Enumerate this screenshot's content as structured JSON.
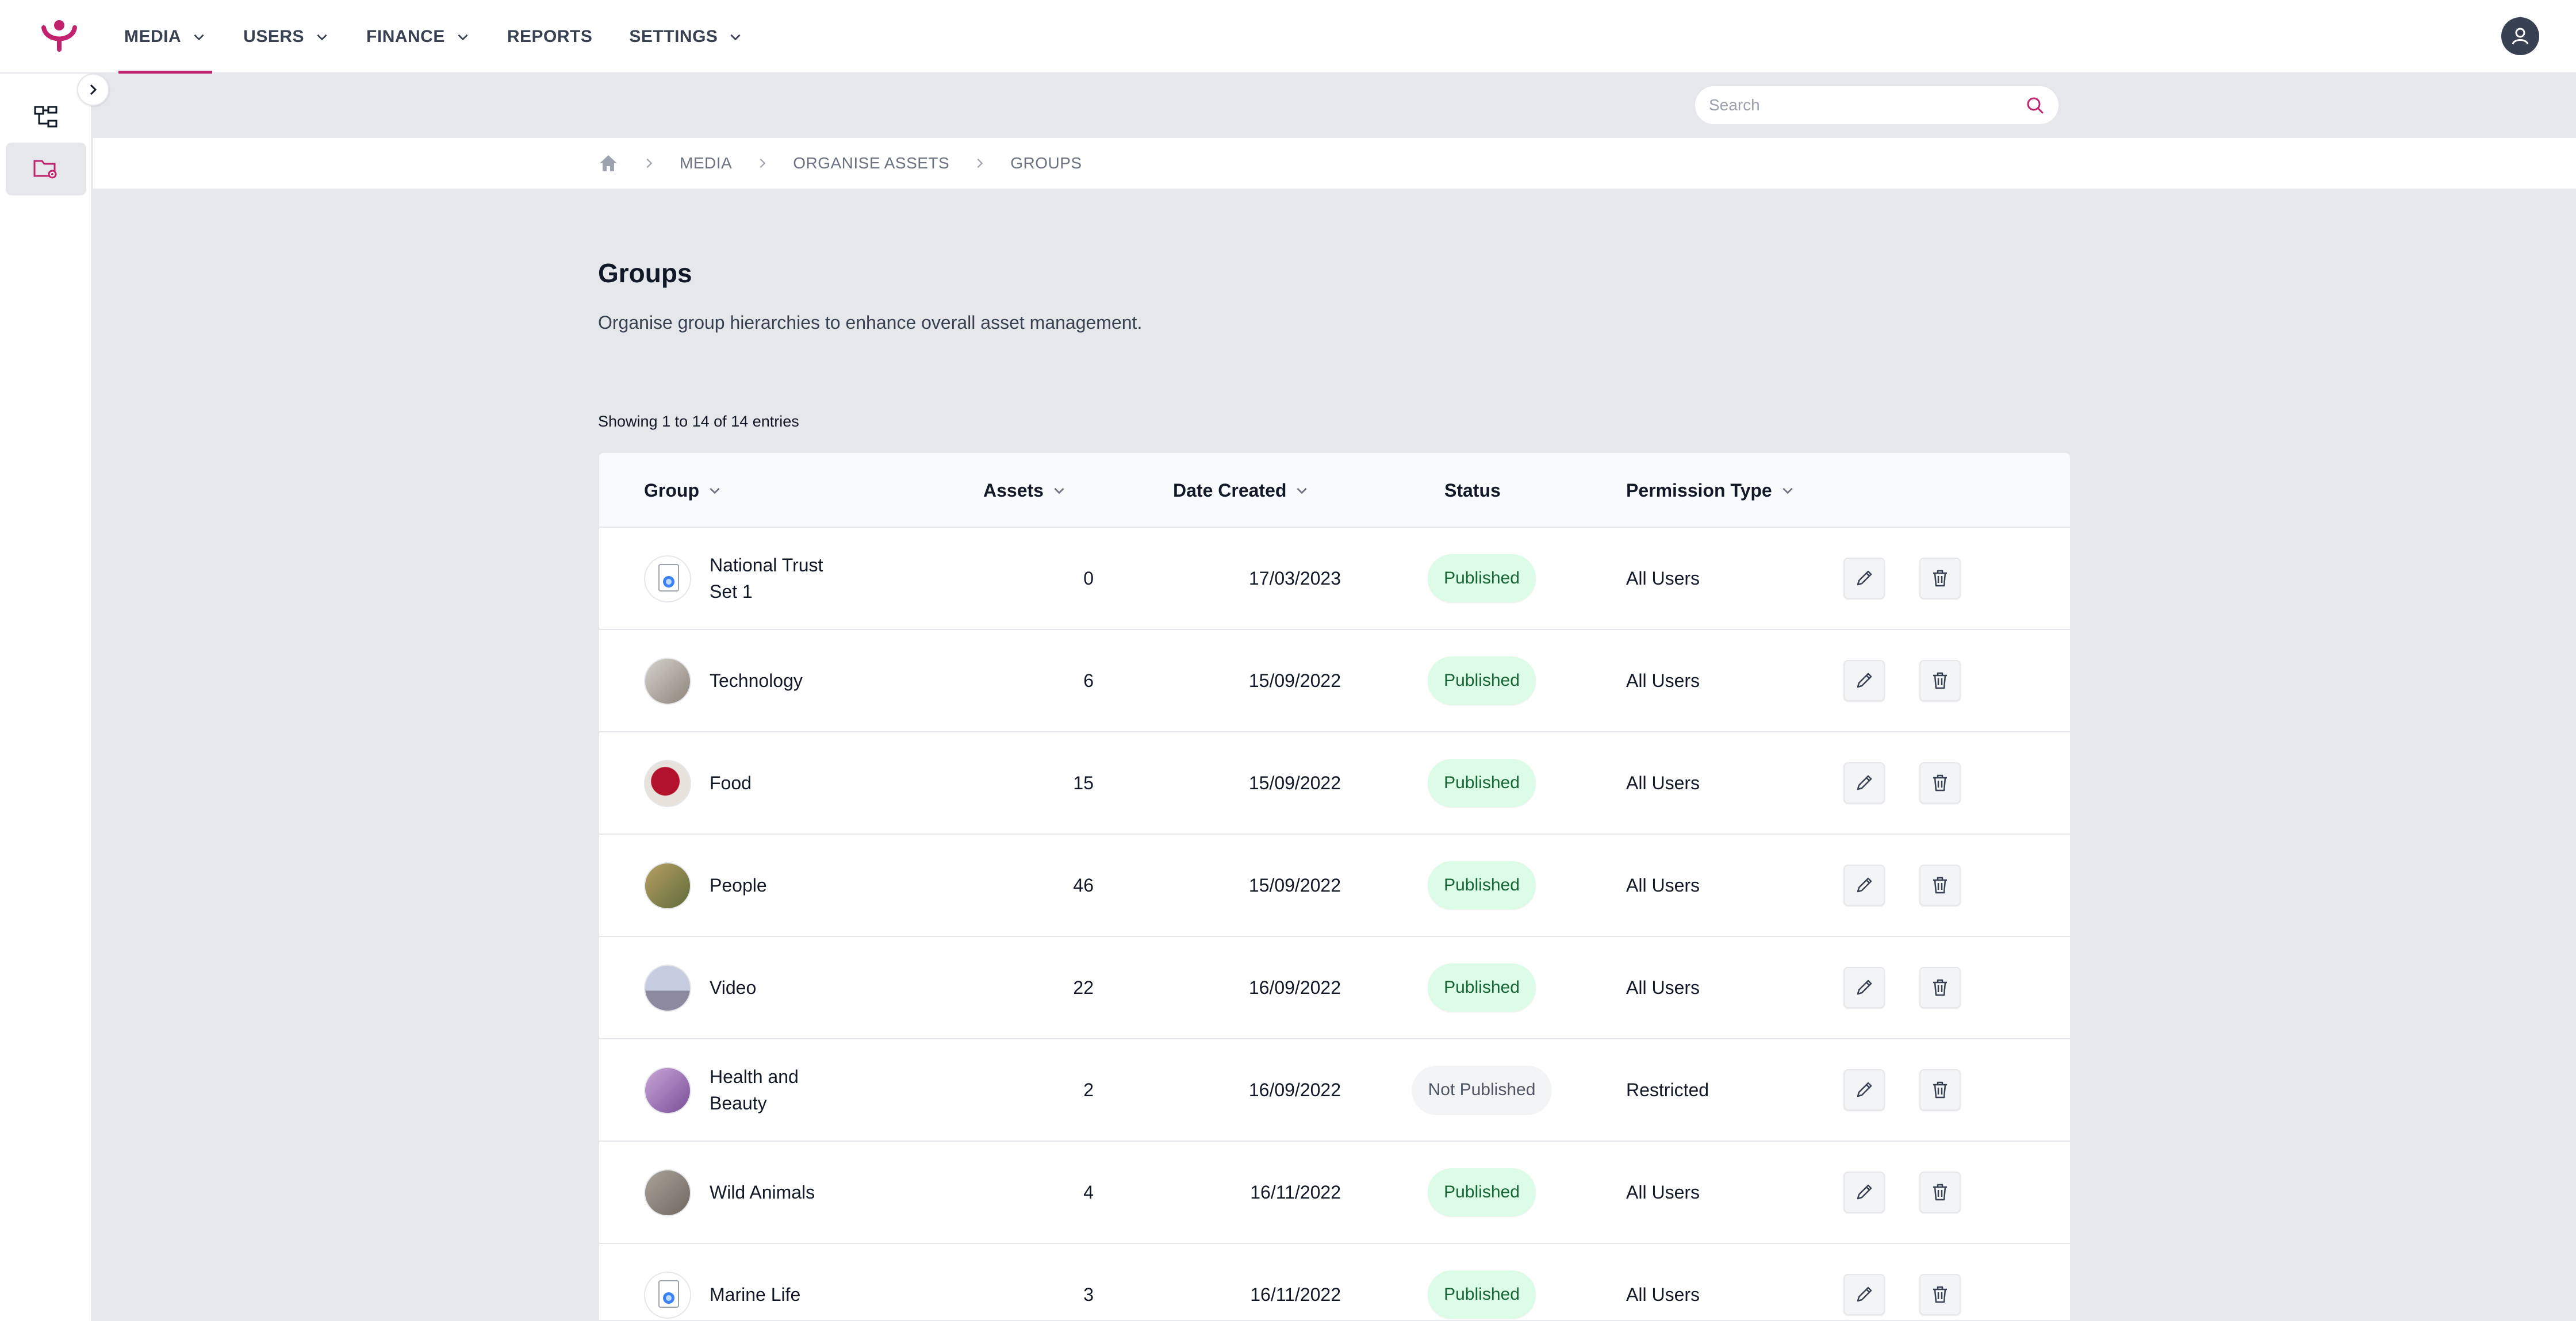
{
  "nav": {
    "items": [
      {
        "label": "MEDIA",
        "has_dropdown": true,
        "active": true
      },
      {
        "label": "USERS",
        "has_dropdown": true,
        "active": false
      },
      {
        "label": "FINANCE",
        "has_dropdown": true,
        "active": false
      },
      {
        "label": "REPORTS",
        "has_dropdown": false,
        "active": false
      },
      {
        "label": "SETTINGS",
        "has_dropdown": true,
        "active": false
      }
    ],
    "accent_color": "#c0226e"
  },
  "search": {
    "placeholder": "Search",
    "value": ""
  },
  "breadcrumb": {
    "items": [
      "MEDIA",
      "ORGANISE ASSETS",
      "GROUPS"
    ]
  },
  "page": {
    "title": "Groups",
    "description": "Organise group hierarchies to enhance overall asset management.",
    "entries": "Showing 1 to 14 of 14 entries"
  },
  "table": {
    "headers": {
      "group": "Group",
      "assets": "Assets",
      "date": "Date Created",
      "status": "Status",
      "permission": "Permission Type"
    },
    "rows": [
      {
        "name": "National Trust Set 1",
        "assets": "0",
        "date": "17/03/2023",
        "status": "Published",
        "permission": "All Users",
        "thumb": "file-placeholder"
      },
      {
        "name": "Technology",
        "assets": "6",
        "date": "15/09/2022",
        "status": "Published",
        "permission": "All Users",
        "thumb": "photo"
      },
      {
        "name": "Food",
        "assets": "15",
        "date": "15/09/2022",
        "status": "Published",
        "permission": "All Users",
        "thumb": "photo"
      },
      {
        "name": "People",
        "assets": "46",
        "date": "15/09/2022",
        "status": "Published",
        "permission": "All Users",
        "thumb": "photo"
      },
      {
        "name": "Video",
        "assets": "22",
        "date": "16/09/2022",
        "status": "Published",
        "permission": "All Users",
        "thumb": "photo"
      },
      {
        "name": "Health and Beauty",
        "assets": "2",
        "date": "16/09/2022",
        "status": "Not Published",
        "permission": "Restricted",
        "thumb": "photo"
      },
      {
        "name": "Wild Animals",
        "assets": "4",
        "date": "16/11/2022",
        "status": "Published",
        "permission": "All Users",
        "thumb": "photo"
      },
      {
        "name": "Marine Life",
        "assets": "3",
        "date": "16/11/2022",
        "status": "Published",
        "permission": "All Users",
        "thumb": "file-placeholder"
      }
    ]
  },
  "status_colors": {
    "published_bg": "#dcfce7",
    "published_text": "#166534",
    "unpublished_bg": "#f3f4f6"
  }
}
